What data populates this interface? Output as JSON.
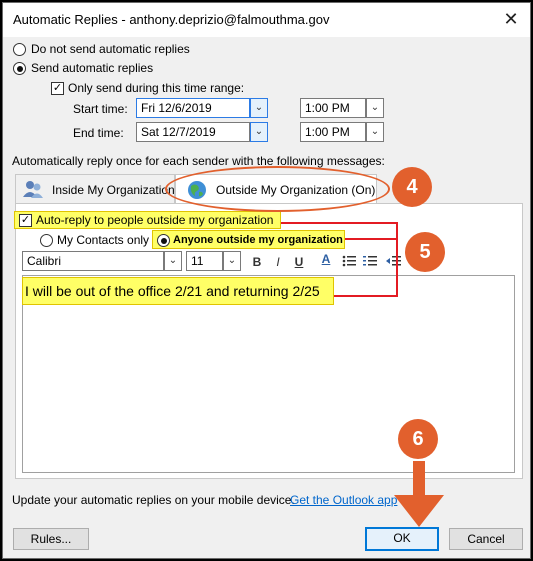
{
  "window": {
    "title": "Automatic Replies - anthony.deprizio@falmouthma.gov",
    "close_glyph": "✕"
  },
  "options": {
    "no_send_label": "Do not send automatic replies",
    "send_label": "Send automatic replies",
    "time_range_label": "Only send during this time range:",
    "start_time_label": "Start time:",
    "end_time_label": "End time:",
    "start_date": "Fri 12/6/2019",
    "start_time": "1:00 PM",
    "end_date": "Sat 12/7/2019",
    "end_time": "1:00 PM"
  },
  "reply_once_label": "Automatically reply once for each sender with the following messages:",
  "tabs": [
    {
      "label": "Inside My Organization",
      "icon": "people-icon"
    },
    {
      "label": "Outside My Organization (On)",
      "icon": "globe-icon"
    }
  ],
  "outside": {
    "auto_reply_label": "Auto-reply to people outside my organization",
    "contacts_only_label": "My Contacts only",
    "anyone_label": "Anyone outside my organization"
  },
  "toolbar": {
    "font": "Calibri",
    "size": "11",
    "bold": "B",
    "italic": "I",
    "underline": "U",
    "font_color": "A"
  },
  "message_text": "I will be out of the office 2/21 and returning 2/25",
  "footer": {
    "text": "Update your automatic replies on your mobile device.",
    "link": "Get the Outlook app"
  },
  "buttons": {
    "rules": "Rules...",
    "ok": "OK",
    "cancel": "Cancel"
  },
  "callouts": [
    "4",
    "5",
    "6"
  ],
  "colors": {
    "highlight": "#ffff66",
    "annotation_red": "#e31b23",
    "callout": "#e2602d",
    "link": "#0066cc",
    "ok_border": "#0078d7"
  }
}
